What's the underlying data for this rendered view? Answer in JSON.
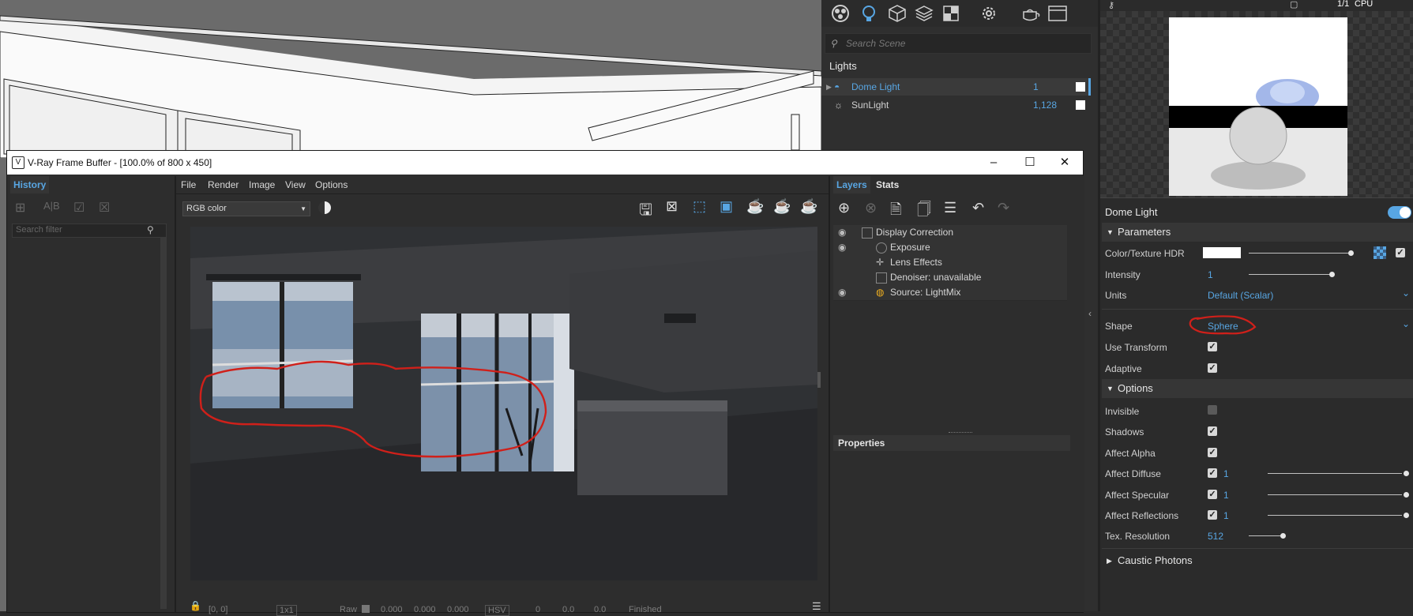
{
  "colors": {
    "accent_blue": "#58a6e3",
    "annotation_red": "#d0201a",
    "panel_bg": "#2b2b2b"
  },
  "asset_editor": {
    "toolbar_icons": [
      "materials-icon",
      "lights-icon",
      "geometry-icon",
      "layers-icon",
      "textures-icon",
      "settings-icon",
      "render-teapot-icon",
      "frame-buffer-icon"
    ],
    "search_placeholder": "Search Scene",
    "category": "Lights",
    "lights": [
      {
        "name": "Dome Light",
        "count": "1",
        "selected": true
      },
      {
        "name": "SunLight",
        "count": "1,128",
        "selected": false
      }
    ]
  },
  "right_panel": {
    "ratio": "1/1",
    "engine": "CPU",
    "light_name": "Dome Light",
    "sections": {
      "parameters": "Parameters",
      "options": "Options",
      "caustic": "Caustic Photons"
    },
    "params": {
      "color_texture": "Color/Texture HDR",
      "intensity_label": "Intensity",
      "intensity_value": "1",
      "units_label": "Units",
      "units_value": "Default (Scalar)",
      "shape_label": "Shape",
      "shape_value": "Sphere",
      "use_transform": "Use Transform",
      "adaptive": "Adaptive"
    },
    "options": {
      "invisible": "Invisible",
      "shadows": "Shadows",
      "affect_alpha": "Affect Alpha",
      "affect_diffuse": "Affect Diffuse",
      "affect_specular": "Affect Specular",
      "affect_reflections": "Affect Reflections",
      "tex_resolution": "Tex. Resolution",
      "diffuse_value": "1",
      "specular_value": "1",
      "reflections_value": "1",
      "tex_res_value": "512"
    }
  },
  "vfb": {
    "title": "V-Ray Frame Buffer - [100.0% of 800 x 450]",
    "history_tab": "History",
    "search_filter_placeholder": "Search filter",
    "menu": [
      "File",
      "Render",
      "Image",
      "View",
      "Options"
    ],
    "channel_select": "RGB color",
    "tabs": {
      "layers": "Layers",
      "stats": "Stats"
    },
    "layers": [
      {
        "name": "Display Correction",
        "eye": true,
        "indent": 0
      },
      {
        "name": "Exposure",
        "eye": true,
        "indent": 1
      },
      {
        "name": "Lens Effects",
        "eye": false,
        "indent": 1
      },
      {
        "name": "Denoiser: unavailable",
        "eye": false,
        "indent": 1
      },
      {
        "name": "Source: LightMix",
        "eye": true,
        "indent": 1
      }
    ],
    "properties_title": "Properties",
    "status": {
      "coords": "[0, 0]",
      "zoom": "1x1",
      "raw_label": "Raw",
      "r": "0.000",
      "g": "0.000",
      "b": "0.000",
      "color_mode": "HSV",
      "h": "0",
      "s": "0.0",
      "v": "0.0",
      "state": "Finished"
    }
  }
}
